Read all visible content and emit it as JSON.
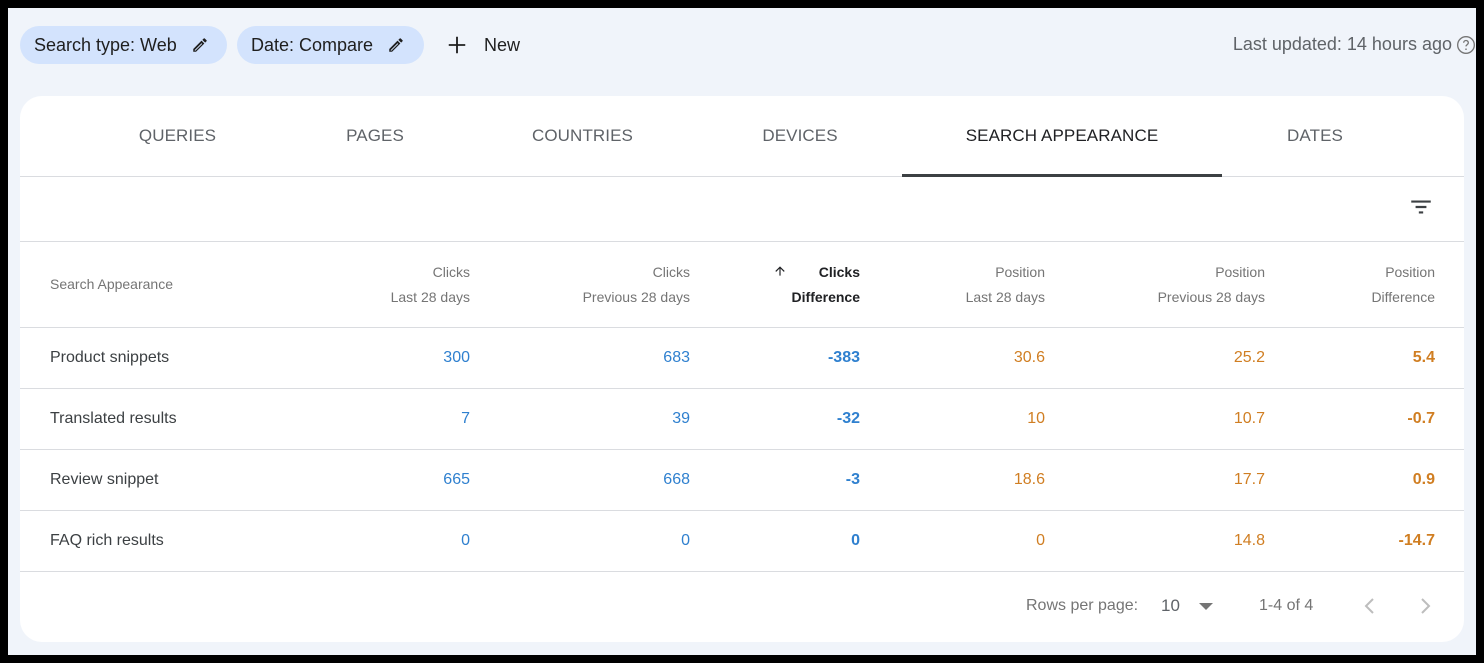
{
  "toolbar": {
    "chips": [
      {
        "label": "Search type: Web",
        "icon": "pencil-icon"
      },
      {
        "label": "Date: Compare",
        "icon": "pencil-icon"
      }
    ],
    "new_label": "New",
    "last_updated": "Last updated: 14 hours ago",
    "help_icon": "help-circle-icon"
  },
  "tabs": [
    {
      "label": "QUERIES",
      "active": false
    },
    {
      "label": "PAGES",
      "active": false
    },
    {
      "label": "COUNTRIES",
      "active": false
    },
    {
      "label": "DEVICES",
      "active": false
    },
    {
      "label": "SEARCH APPEARANCE",
      "active": true
    },
    {
      "label": "DATES",
      "active": false
    }
  ],
  "filter_icon": "filter-list-icon",
  "table": {
    "columns": [
      {
        "line1": "Search Appearance",
        "line2": ""
      },
      {
        "line1": "Clicks",
        "line2": "Last 28 days"
      },
      {
        "line1": "Clicks",
        "line2": "Previous 28 days"
      },
      {
        "line1": "Clicks",
        "line2": "Difference",
        "sorted": "ascending"
      },
      {
        "line1": "Position",
        "line2": "Last 28 days"
      },
      {
        "line1": "Position",
        "line2": "Previous 28 days"
      },
      {
        "line1": "Position",
        "line2": "Difference"
      }
    ],
    "rows": [
      {
        "name": "Product snippets",
        "clicks_last": "300",
        "clicks_prev": "683",
        "clicks_diff": "-383",
        "pos_last": "30.6",
        "pos_prev": "25.2",
        "pos_diff": "5.4"
      },
      {
        "name": "Translated results",
        "clicks_last": "7",
        "clicks_prev": "39",
        "clicks_diff": "-32",
        "pos_last": "10",
        "pos_prev": "10.7",
        "pos_diff": "-0.7"
      },
      {
        "name": "Review snippet",
        "clicks_last": "665",
        "clicks_prev": "668",
        "clicks_diff": "-3",
        "pos_last": "18.6",
        "pos_prev": "17.7",
        "pos_diff": "0.9"
      },
      {
        "name": "FAQ rich results",
        "clicks_last": "0",
        "clicks_prev": "0",
        "clicks_diff": "0",
        "pos_last": "0",
        "pos_prev": "14.8",
        "pos_diff": "-14.7"
      }
    ]
  },
  "pagination": {
    "rows_per_page_label": "Rows per page:",
    "rows_per_page_value": "10",
    "range": "1-4 of 4"
  },
  "colors": {
    "clicks": "#2f80cf",
    "position": "#d07e22",
    "chip_bg": "#d3e3fd",
    "page_bg": "#f0f4fa"
  }
}
